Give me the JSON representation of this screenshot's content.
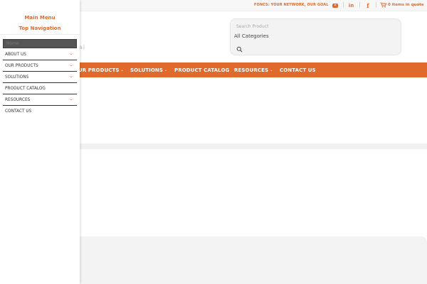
{
  "topbar": {
    "tagline": "FONCS: YOUR NETWORK, OUR GOAL",
    "social": {
      "linkedin": "in",
      "facebook": "f"
    },
    "cart_label": "0 items in quote"
  },
  "search": {
    "placeholder": "Search Product",
    "category": "All Categories"
  },
  "nav": {
    "items": [
      {
        "label": "UR PRODUCTS",
        "has_dropdown": true
      },
      {
        "label": "SOLUTIONS",
        "has_dropdown": true
      },
      {
        "label": "PRODUCT CATALOG",
        "has_dropdown": false
      },
      {
        "label": "RESOURCES",
        "has_dropdown": true
      },
      {
        "label": "CONTACT US",
        "has_dropdown": false
      }
    ],
    "caret": "⌄"
  },
  "drawer": {
    "close": "×",
    "main_menu": "Main Menu",
    "top_navigation": "Top Navigation",
    "home": "Home",
    "chevron": "⌄",
    "items": [
      {
        "label": "ABOUT US",
        "has_dropdown": true
      },
      {
        "label": "OUR PRODUCTS",
        "has_dropdown": true
      },
      {
        "label": "SOLUTIONS",
        "has_dropdown": true
      },
      {
        "label": "PRODUCT CATALOG",
        "has_dropdown": false
      },
      {
        "label": "RESOURCES",
        "has_dropdown": true
      },
      {
        "label": "CONTACT US",
        "has_dropdown": false
      }
    ]
  },
  "colors": {
    "accent": "#e06a2b",
    "topbar": "#f7f7f7",
    "home_bg": "#555555"
  },
  "icons": [
    "youtube-icon",
    "linkedin-icon",
    "facebook-icon",
    "cart-icon",
    "search-icon",
    "chevron-down-icon",
    "close-icon"
  ]
}
